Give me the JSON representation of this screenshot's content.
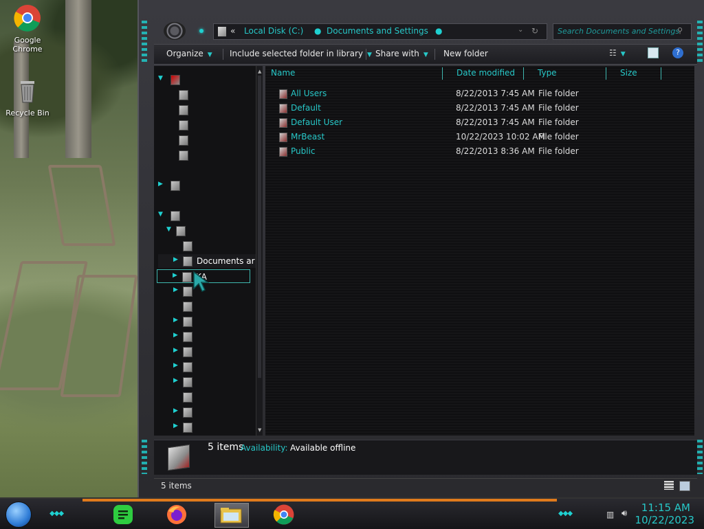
{
  "desktop": {
    "icons": [
      {
        "name": "Google Chrome"
      },
      {
        "name": "Recycle Bin"
      }
    ]
  },
  "address": {
    "prefix": "«",
    "segments": [
      "Local Disk (C:)",
      "Documents and Settings"
    ]
  },
  "search": {
    "placeholder": "Search Documents and Settings"
  },
  "toolbar": {
    "organize": "Organize",
    "include": "Include selected folder in library",
    "share": "Share with",
    "new_folder": "New folder"
  },
  "nav": {
    "documents_item": "Documents ar",
    "focused_item": "KA"
  },
  "columns": {
    "name": "Name",
    "date": "Date modified",
    "type": "Type",
    "size": "Size"
  },
  "files": [
    {
      "name": "All Users",
      "date": "8/22/2013 7:45 AM",
      "type": "File folder"
    },
    {
      "name": "Default",
      "date": "8/22/2013 7:45 AM",
      "type": "File folder"
    },
    {
      "name": "Default User",
      "date": "8/22/2013 7:45 AM",
      "type": "File folder"
    },
    {
      "name": "MrBeast",
      "date": "10/22/2023 10:02 AM",
      "type": "File folder"
    },
    {
      "name": "Public",
      "date": "8/22/2013 8:36 AM",
      "type": "File folder"
    }
  ],
  "details": {
    "count": "5 items",
    "availability_label": "Availability:",
    "availability_value": "Available offline"
  },
  "status": {
    "text": "5 items"
  },
  "clock": {
    "time": "11:15 AM",
    "date": "10/22/2023"
  },
  "colors": {
    "accent": "#27c8c8",
    "taskbar_strip": "#e07a1c"
  }
}
